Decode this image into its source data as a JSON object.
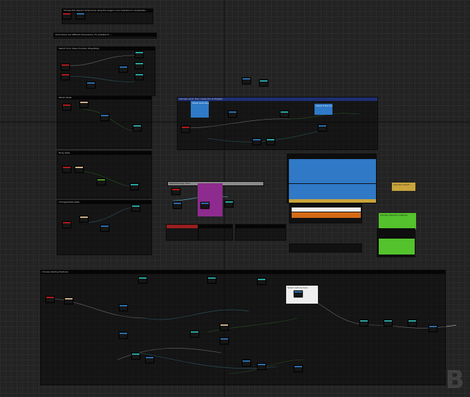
{
  "canvas": {
    "type": "blueprint-graph"
  },
  "comments": [
    {
      "id": "c_top",
      "label": "Choose the desired dimensions using the plugin's own interface to manipulate..."
    },
    {
      "id": "c_intro",
      "label": "Since there are different dimensions, it's possible to ..."
    },
    {
      "id": "c_play",
      "label": "Switch from divers function (Play/Stop)"
    },
    {
      "id": "c_mode",
      "label": "Which Mode"
    },
    {
      "id": "c_body",
      "label": "Body state"
    },
    {
      "id": "c_change",
      "label": "Changes/stats state"
    },
    {
      "id": "c_alloc",
      "label": "Allocate Input, then create the UI Widgets"
    },
    {
      "id": "c_bottom",
      "label": "Choose starting Features"
    },
    {
      "id": "c_dummy",
      "label": "Select/Change dims"
    }
  ],
  "notes": [
    {
      "id": "n_blue_top",
      "label": "Check Auto-target"
    },
    {
      "id": "n_blue_right",
      "label": "Check if the UI exists"
    },
    {
      "id": "n_yellow",
      "label": "Use the correct ..."
    },
    {
      "id": "n_green",
      "label": "Change detection settings"
    },
    {
      "id": "n_white",
      "label": "Select options here"
    }
  ],
  "watermark": "B"
}
